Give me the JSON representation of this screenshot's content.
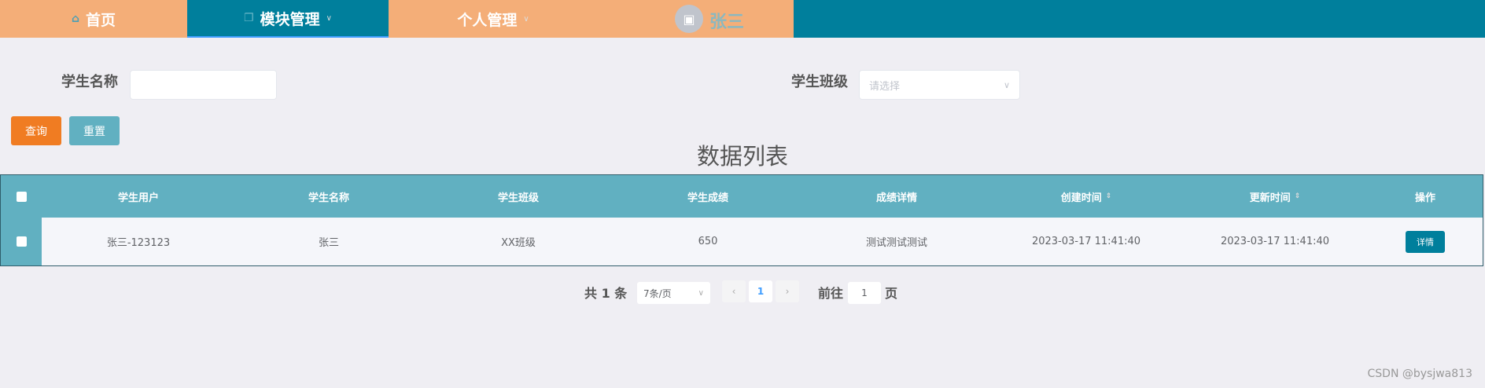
{
  "nav": {
    "home": "首页",
    "module": "模块管理",
    "personal": "个人管理",
    "user": "张三"
  },
  "search": {
    "name_label": "学生名称",
    "name_value": "",
    "class_label": "学生班级",
    "class_placeholder": "请选择",
    "query": "查询",
    "reset": "重置"
  },
  "title": "数据列表",
  "table": {
    "headers": [
      "学生用户",
      "学生名称",
      "学生班级",
      "学生成绩",
      "成绩详情",
      "创建时间",
      "更新时间",
      "操作"
    ],
    "rows": [
      {
        "user": "张三-123123",
        "name": "张三",
        "class": "XX班级",
        "score": "650",
        "detail": "测试测试测试",
        "created": "2023-03-17 11:41:40",
        "updated": "2023-03-17 11:41:40",
        "action": "详情"
      }
    ]
  },
  "pagination": {
    "total": "共 1 条",
    "page_size": "7条/页",
    "current": "1",
    "goto_label": "前往",
    "goto_value": "1",
    "page_suffix": "页"
  },
  "watermark": "CSDN @bysjwa813"
}
